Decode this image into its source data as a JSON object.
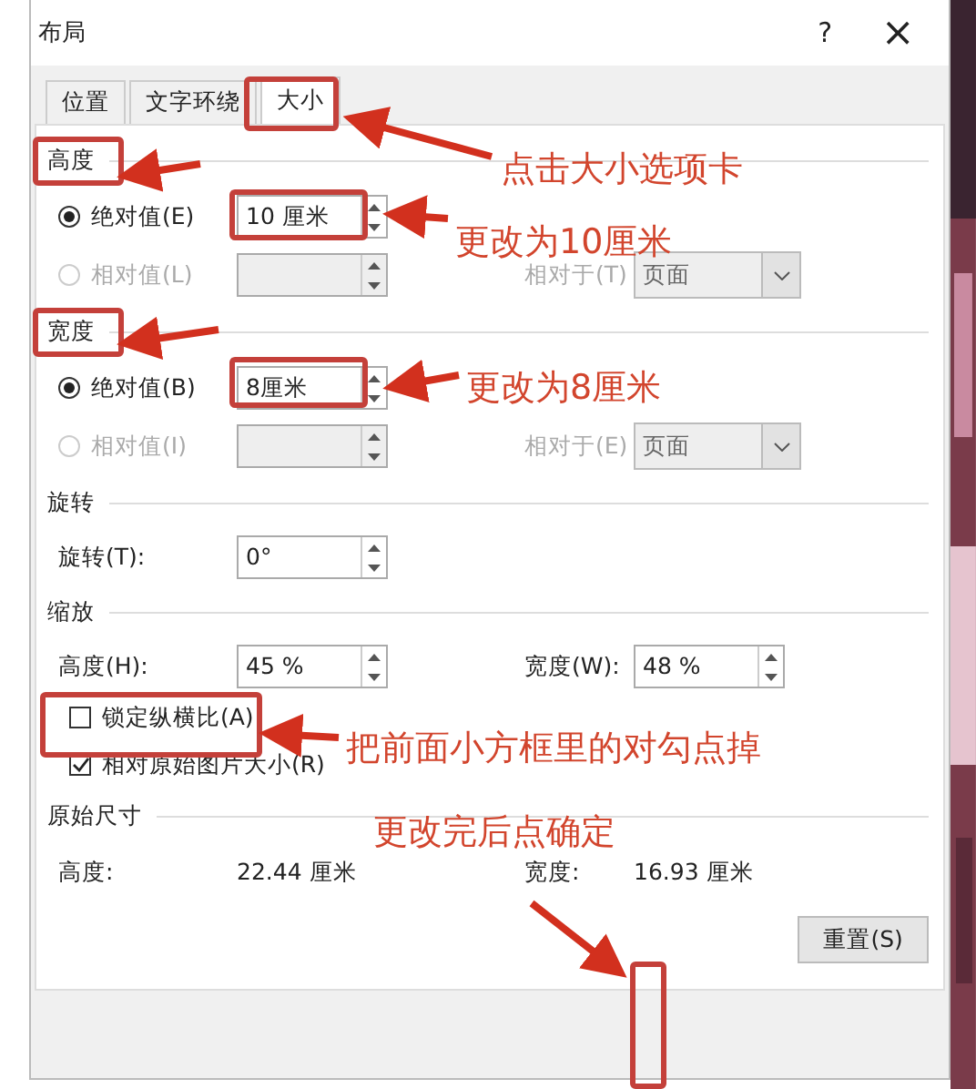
{
  "window": {
    "title": "布局",
    "help": "?",
    "close": "×"
  },
  "tabs": [
    {
      "label": "位置",
      "selected": false
    },
    {
      "label": "文字环绕",
      "selected": false
    },
    {
      "label": "大小",
      "selected": true
    }
  ],
  "sections": [
    {
      "title": "高度",
      "rows": [
        {
          "kind": "radio",
          "label": "绝对值(E)",
          "selected": true,
          "disabled": false,
          "value": "10 厘米"
        },
        {
          "kind": "radio",
          "label": "相对值(L)",
          "selected": false,
          "disabled": true,
          "relative_label": "相对于(T)",
          "relative_value": "页面"
        }
      ]
    },
    {
      "title": "宽度",
      "rows": [
        {
          "kind": "radio",
          "label": "绝对值(B)",
          "selected": true,
          "disabled": false,
          "value": "8厘米"
        },
        {
          "kind": "radio",
          "label": "相对值(I)",
          "selected": false,
          "disabled": true,
          "relative_label": "相对于(E)",
          "relative_value": "页面"
        }
      ]
    },
    {
      "title": "旋转",
      "rows": [
        {
          "kind": "spin",
          "label": "旋转(T):",
          "value": "0°"
        }
      ]
    },
    {
      "title": "缩放",
      "rows": [
        {
          "kind": "spin",
          "label": "高度(H):",
          "value": "45 %",
          "label_2": "宽度(W):",
          "value_2": "48 %"
        },
        {
          "kind": "checkbox",
          "label": "锁定纵横比(A)",
          "checked": false
        },
        {
          "kind": "checkbox",
          "label": "相对原始图片大小(R)",
          "checked": true
        }
      ]
    },
    {
      "title": "原始尺寸",
      "rows": [
        {
          "kind": "readout",
          "label": "高度:",
          "value": "22.44 厘米",
          "label_2": "宽度:",
          "value_2": "16.93 厘米"
        }
      ]
    }
  ],
  "buttons": [
    {
      "label": "重置(S)"
    }
  ],
  "annotations": [
    {
      "text": "点击大小选项卡"
    },
    {
      "text": "更改为10厘米"
    },
    {
      "text": "更改为8厘米"
    },
    {
      "text": "把前面小方框里的对勾点掉"
    },
    {
      "text": "更改完后点确定"
    }
  ]
}
